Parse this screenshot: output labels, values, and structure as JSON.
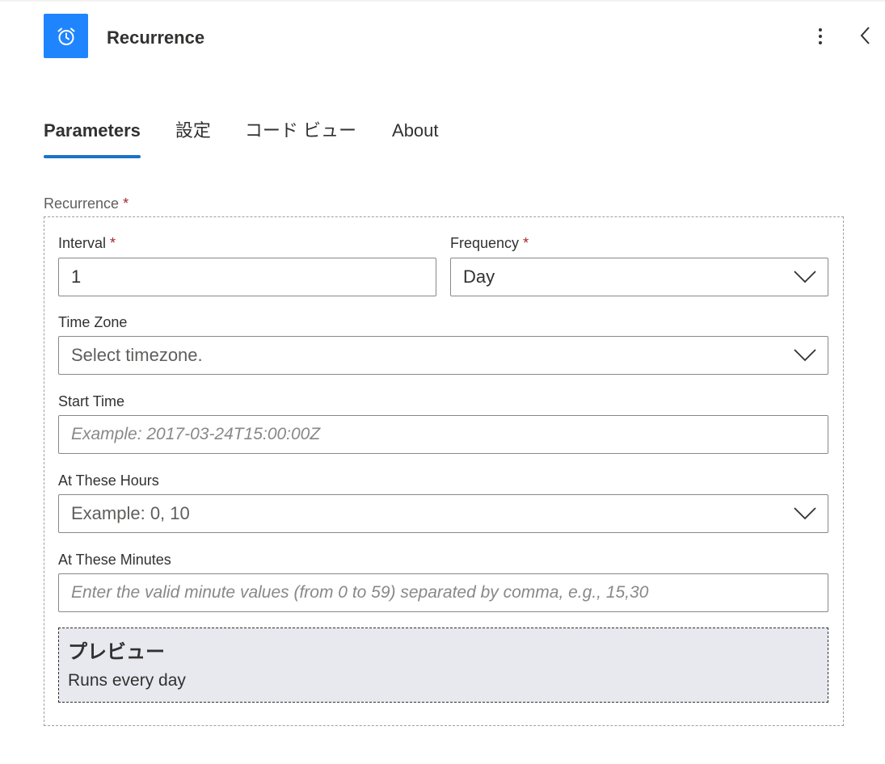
{
  "header": {
    "title": "Recurrence",
    "icon": "alarm-clock-icon",
    "accent_color": "#1f85ff"
  },
  "tabs": [
    {
      "label": "Parameters",
      "active": true
    },
    {
      "label": "設定",
      "active": false
    },
    {
      "label": "コード ビュー",
      "active": false
    },
    {
      "label": "About",
      "active": false
    }
  ],
  "recurrence": {
    "label": "Recurrence",
    "required_mark": "*",
    "interval": {
      "label": "Interval",
      "required_mark": "*",
      "value": "1"
    },
    "frequency": {
      "label": "Frequency",
      "required_mark": "*",
      "value": "Day"
    },
    "time_zone": {
      "label": "Time Zone",
      "placeholder": "Select timezone."
    },
    "start_time": {
      "label": "Start Time",
      "placeholder": "Example: 2017-03-24T15:00:00Z"
    },
    "at_these_hours": {
      "label": "At These Hours",
      "placeholder": "Example: 0, 10"
    },
    "at_these_minutes": {
      "label": "At These Minutes",
      "placeholder": "Enter the valid minute values (from 0 to 59) separated by comma, e.g., 15,30"
    }
  },
  "preview": {
    "title": "プレビュー",
    "text": "Runs every day"
  }
}
